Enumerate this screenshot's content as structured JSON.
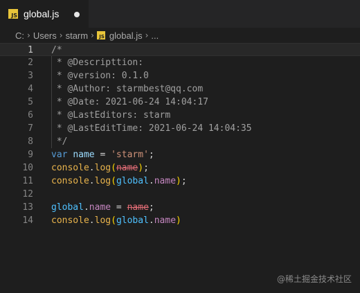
{
  "tab": {
    "title": "global.js",
    "badge": "JS"
  },
  "breadcrumb": {
    "parts": [
      "C:",
      "Users",
      "starm",
      "global.js",
      "..."
    ]
  },
  "gutter": [
    "1",
    "2",
    "3",
    "4",
    "5",
    "6",
    "7",
    "8",
    "9",
    "10",
    "11",
    "12",
    "13",
    "14"
  ],
  "code": {
    "l1": "/*",
    "l2": " * @Descripttion:",
    "l3": " * @version: 0.1.0",
    "l4": " * @Author: starmbest@qq.com",
    "l5": " * @Date: 2021-06-24 14:04:17",
    "l6": " * @LastEditors: starm",
    "l7": " * @LastEditTime: 2021-06-24 14:04:35",
    "l8": " */",
    "l9": {
      "kw": "var",
      "name": "name",
      "eq": " = ",
      "str": "'starm'",
      "semi": ";"
    },
    "l10": {
      "obj": "console",
      "dot": ".",
      "fn": "log",
      "open": "(",
      "arg": "name",
      "close": ")",
      "semi": ";"
    },
    "l11": {
      "obj": "console",
      "dot": ".",
      "fn": "log",
      "open": "(",
      "g": "global",
      "dot2": ".",
      "prop": "name",
      "close": ")",
      "semi": ";"
    },
    "l13": {
      "g": "global",
      "dot": ".",
      "prop": "name",
      "eq": " = ",
      "rhs": "name",
      "semi": ";"
    },
    "l14": {
      "obj": "console",
      "dot": ".",
      "fn": "log",
      "open": "(",
      "g": "global",
      "dot2": ".",
      "prop": "name",
      "close": ")"
    }
  },
  "watermark": "@稀土掘金技术社区",
  "colors": {
    "editor_bg": "#1e1e1e",
    "tabbar_bg": "#252526",
    "js_badge": "#e8c53a"
  }
}
